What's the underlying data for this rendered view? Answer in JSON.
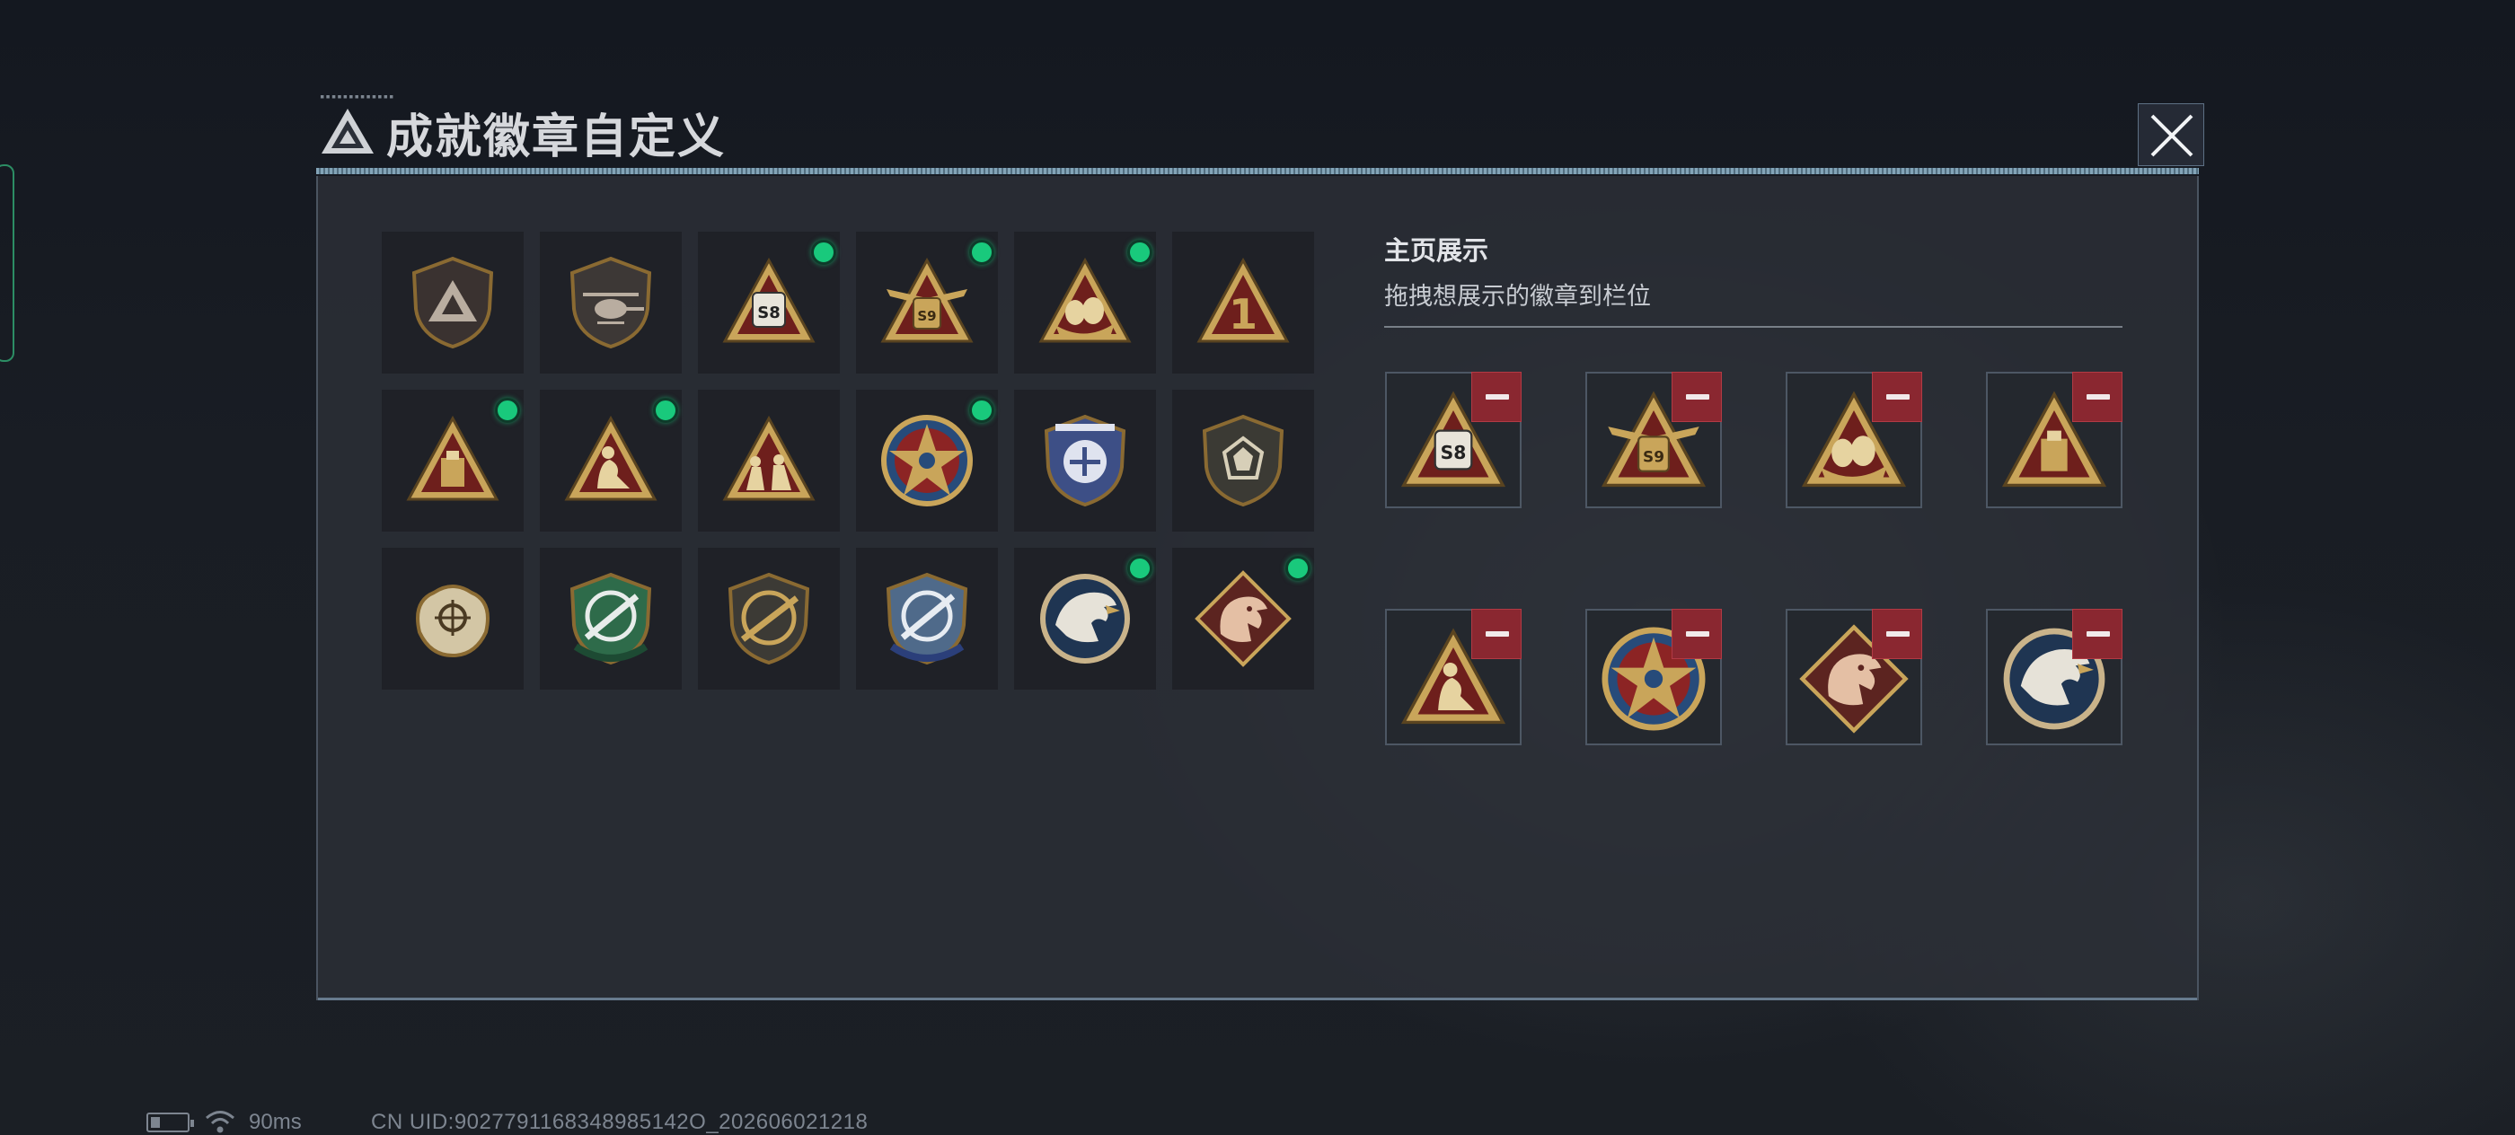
{
  "window": {
    "title": "成就徽章自定义",
    "close_icon": "close-icon"
  },
  "collection": {
    "badges": [
      {
        "id": "b1",
        "icon": "pyramid-shield-badge",
        "equipped": false
      },
      {
        "id": "b2",
        "icon": "helicopter-shield-badge",
        "equipped": false
      },
      {
        "id": "b3",
        "icon": "s8-triangle-badge",
        "number": "S8",
        "equipped": true
      },
      {
        "id": "b4",
        "icon": "s9-winged-triangle-badge",
        "number": "S9",
        "equipped": true
      },
      {
        "id": "b5",
        "icon": "golden-egg-triangle-badge",
        "equipped": true
      },
      {
        "id": "b6",
        "icon": "number-one-triangle-badge",
        "number": "1",
        "equipped": false
      },
      {
        "id": "b7",
        "icon": "gold-bar-triangle-badge",
        "equipped": true
      },
      {
        "id": "b8",
        "icon": "kneeling-soldier-triangle-badge",
        "equipped": true
      },
      {
        "id": "b9",
        "icon": "squad-triangle-badge",
        "equipped": false
      },
      {
        "id": "b10",
        "icon": "star-medal-badge",
        "equipped": true
      },
      {
        "id": "b11",
        "icon": "blue-wing-shield-badge",
        "equipped": false
      },
      {
        "id": "b12",
        "icon": "gem-shield-badge",
        "equipped": false
      },
      {
        "id": "b13",
        "icon": "crosshair-skull-badge",
        "equipped": false
      },
      {
        "id": "b14",
        "icon": "green-rifle-shield-badge",
        "equipped": false
      },
      {
        "id": "b15",
        "icon": "gold-rifle-shield-badge",
        "equipped": false
      },
      {
        "id": "b16",
        "icon": "blue-rifle-shield-badge",
        "equipped": false
      },
      {
        "id": "b17",
        "icon": "eagle-round-badge",
        "equipped": true
      },
      {
        "id": "b18",
        "icon": "dragon-diamond-badge",
        "equipped": true
      }
    ]
  },
  "showcase": {
    "title": "主页展示",
    "subtitle": "拖拽想展示的徽章到栏位",
    "remove_icon": "minus-icon",
    "slots": [
      {
        "icon": "s8-triangle-badge",
        "number": "S8"
      },
      {
        "icon": "s9-winged-triangle-badge",
        "number": "S9"
      },
      {
        "icon": "golden-egg-triangle-badge"
      },
      {
        "icon": "gold-bar-triangle-badge"
      },
      {
        "icon": "kneeling-soldier-triangle-badge"
      },
      {
        "icon": "star-medal-badge"
      },
      {
        "icon": "dragon-diamond-badge"
      },
      {
        "icon": "eagle-round-badge"
      }
    ]
  },
  "status_bar": {
    "ping": "90ms",
    "uid": "CN UID:9027791168348985142O_202606021218"
  },
  "colors": {
    "equipped_dot": "#19c97c",
    "remove_button": "#8a2730",
    "badge_gold": "#c9a55a",
    "badge_red": "#6e1f1c"
  }
}
